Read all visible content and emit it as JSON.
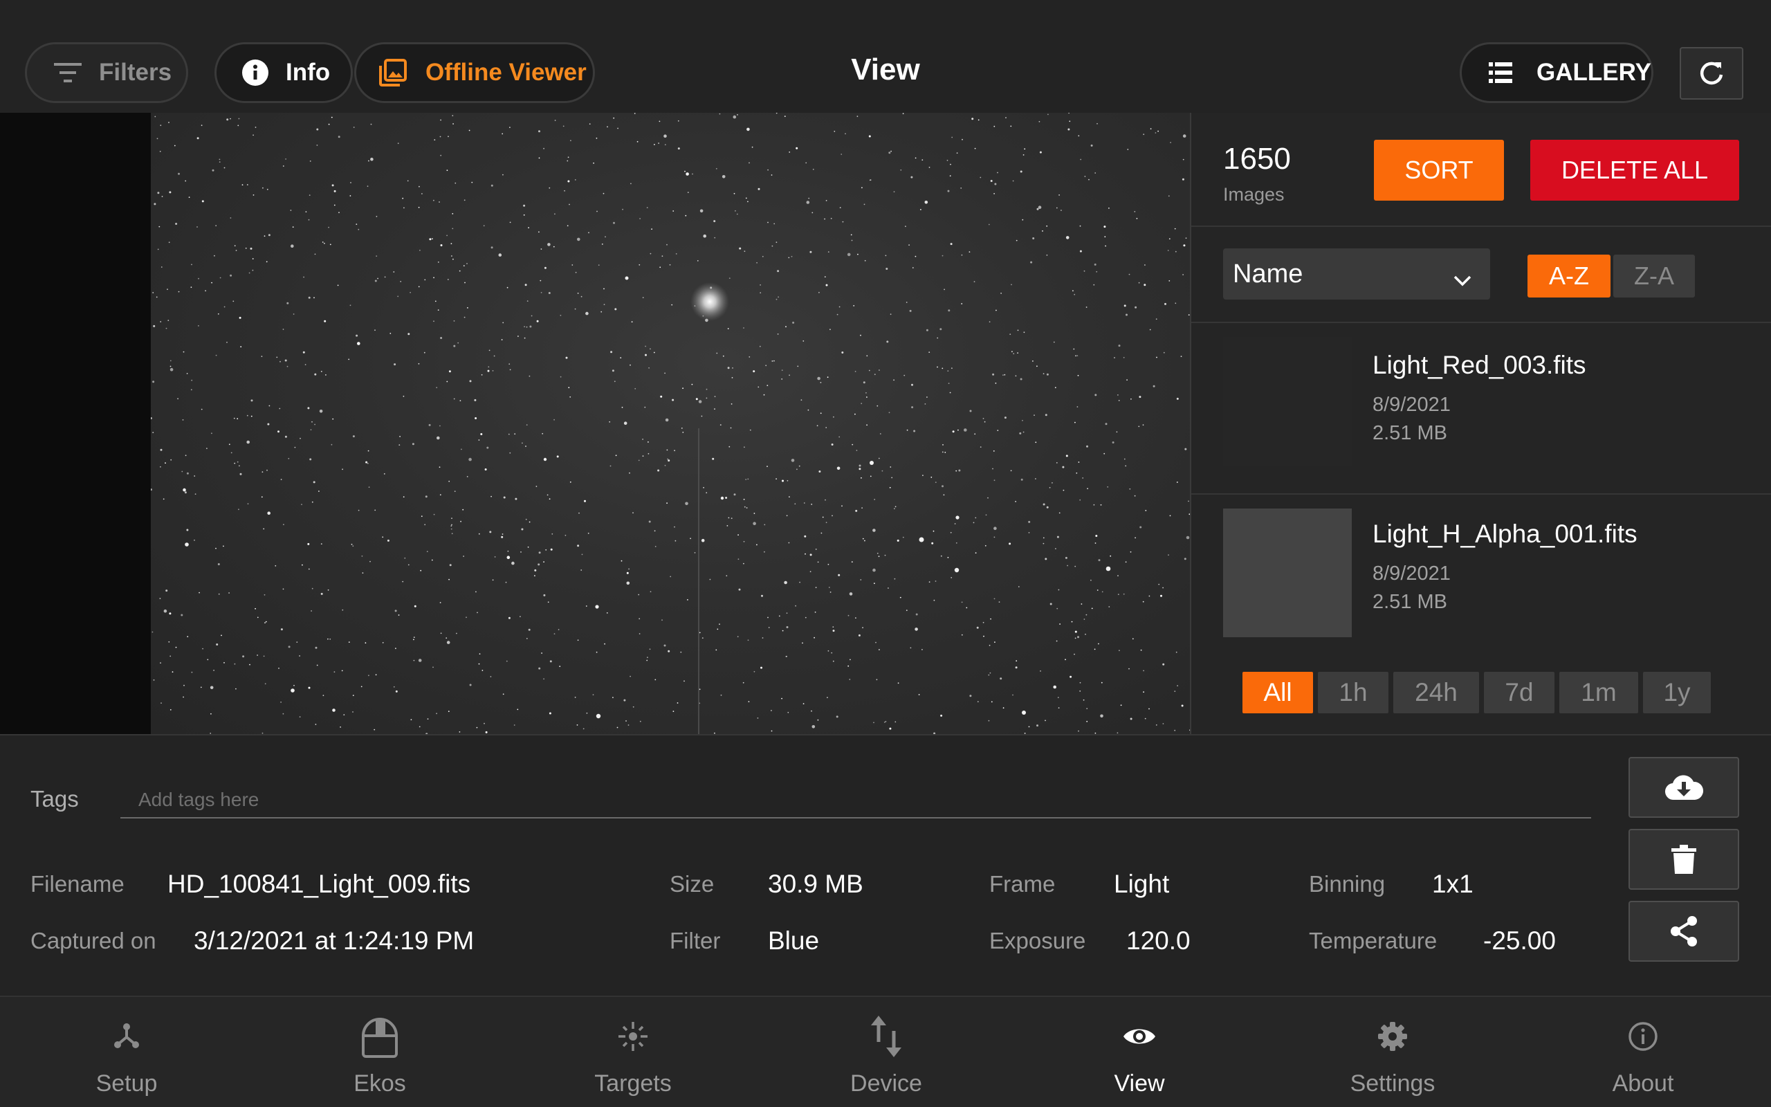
{
  "topbar": {
    "filters_label": "Filters",
    "info_label": "Info",
    "offline_viewer_label": "Offline Viewer",
    "title": "View",
    "gallery_label": "GALLERY"
  },
  "gallery": {
    "count": "1650",
    "count_label": "Images",
    "sort_label": "SORT",
    "delete_all_label": "DELETE ALL",
    "sort_by": "Name",
    "order_asc_label": "A-Z",
    "order_desc_label": "Z-A",
    "selected_order": "A-Z",
    "files": [
      {
        "name": "Light_Red_003.fits",
        "date": "8/9/2021",
        "size": "2.51 MB"
      },
      {
        "name": "Light_H_Alpha_001.fits",
        "date": "8/9/2021",
        "size": "2.51 MB"
      }
    ],
    "time_filters": [
      "All",
      "1h",
      "24h",
      "7d",
      "1m",
      "1y"
    ],
    "active_time_filter": "All"
  },
  "details": {
    "tags_label": "Tags",
    "tags_placeholder": "Add tags here",
    "filename_label": "Filename",
    "filename": "HD_100841_Light_009.fits",
    "captured_label": "Captured on",
    "captured": "3/12/2021 at 1:24:19 PM",
    "size_label": "Size",
    "size": "30.9 MB",
    "filter_label": "Filter",
    "filter": "Blue",
    "frame_label": "Frame",
    "frame": "Light",
    "exposure_label": "Exposure",
    "exposure": "120.0",
    "binning_label": "Binning",
    "binning": "1x1",
    "temperature_label": "Temperature",
    "temperature": "-25.00"
  },
  "nav": {
    "items": [
      {
        "label": "Setup",
        "icon": "setup-icon"
      },
      {
        "label": "Ekos",
        "icon": "ekos-icon"
      },
      {
        "label": "Targets",
        "icon": "targets-icon"
      },
      {
        "label": "Device",
        "icon": "device-icon"
      },
      {
        "label": "View",
        "icon": "eye-icon"
      },
      {
        "label": "Settings",
        "icon": "gear-icon"
      },
      {
        "label": "About",
        "icon": "about-icon"
      }
    ],
    "active": "View"
  },
  "colors": {
    "accent": "#fa6a0a",
    "accent_text": "#f58a1f",
    "danger": "#d80d1f",
    "background": "#232323"
  }
}
